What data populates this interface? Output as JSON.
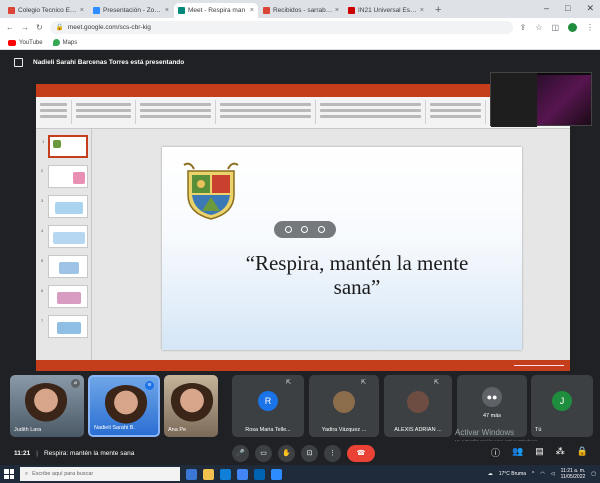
{
  "browser": {
    "tabs": [
      {
        "label": "Colegio Tecnico Escolar -",
        "color": "#db4437",
        "active": false
      },
      {
        "label": "Presentación - Zoom",
        "color": "#2d8cff",
        "active": false
      },
      {
        "label": "Meet - Respira man",
        "color": "#00897b",
        "active": true
      },
      {
        "label": "Recibidos - sarrabdarse",
        "color": "#db4437",
        "active": false
      },
      {
        "label": "IN21 Universal Estéreo",
        "color": "#c00",
        "active": false
      }
    ],
    "new_tab": "+",
    "url": "meet.google.com/scs-cbr-kig",
    "bookmarks": [
      {
        "label": "YouTube"
      },
      {
        "label": "Maps"
      }
    ]
  },
  "meet": {
    "presenting_banner": "Nadieli Sarahi Barcenas Torres está presentando",
    "meeting_time": "11:21",
    "meeting_name": "Respira: mantén la mente sana",
    "watermark_title": "Activar Windows",
    "watermark_sub": "Ve a Configuración para activar Windows."
  },
  "slide": {
    "quote": "“Respira, mantén la mente sana”"
  },
  "participants": [
    {
      "name": "Judith Lara",
      "type": "video"
    },
    {
      "name": "Nadieli Sarahi B.",
      "type": "video",
      "active_speaker": true
    },
    {
      "name": "Ana Pe",
      "type": "video"
    },
    {
      "name": "Rosa Maria Telle...",
      "type": "avatar",
      "initial": "R",
      "color": "#1a73e8"
    },
    {
      "name": "Yadira Vázquez ...",
      "type": "avatar",
      "initial": "",
      "color": "#8b6d4b"
    },
    {
      "name": "ALEXIS ADRIAN ...",
      "type": "avatar",
      "initial": "",
      "color": "#6d4c41"
    },
    {
      "name": "47 más",
      "type": "more"
    },
    {
      "name": "Tú",
      "type": "avatar",
      "initial": "J",
      "color": "#1e8e3e"
    }
  ],
  "taskbar": {
    "search_placeholder": "Escribe aquí para buscar",
    "weather": "17°C Bruma",
    "time": "11:21 a. m.",
    "date": "11/05/2022"
  }
}
